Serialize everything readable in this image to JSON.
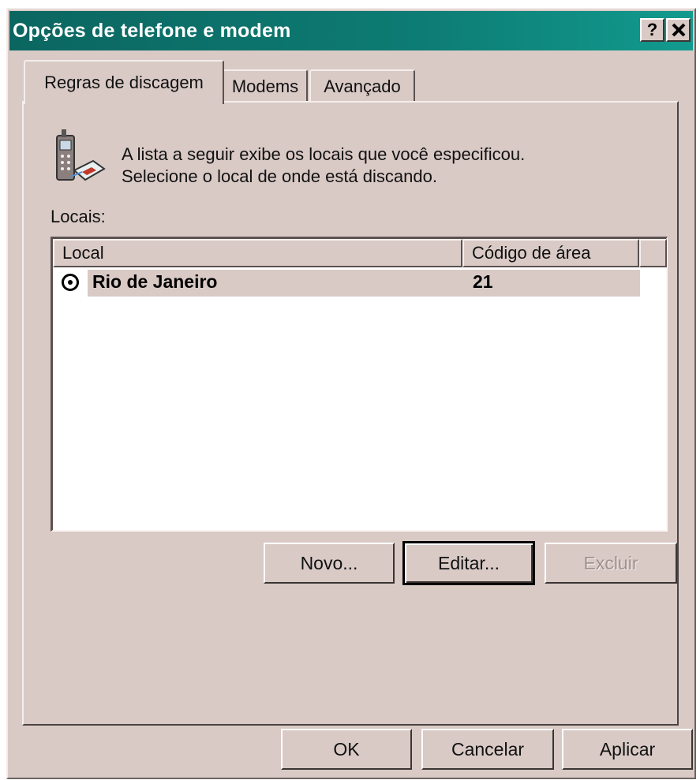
{
  "window": {
    "title": "Opções de telefone e modem",
    "help_button": "?",
    "close_button": "✕"
  },
  "tabs": [
    {
      "label": "Regras de discagem",
      "active": true
    },
    {
      "label": "Modems",
      "active": false
    },
    {
      "label": "Avançado",
      "active": false
    }
  ],
  "intro": {
    "line1": "A lista a seguir exibe os locais que você especificou.",
    "line2": "Selecione o local de onde está discando.",
    "icon": "phone-modem-icon"
  },
  "locations": {
    "label": "Locais:",
    "columns": [
      "Local",
      "Código de área"
    ],
    "rows": [
      {
        "local": "Rio de Janeiro",
        "codigo": "21",
        "selected": true
      }
    ]
  },
  "list_buttons": {
    "new": "Novo...",
    "edit": "Editar...",
    "delete": "Excluir"
  },
  "dialog_buttons": {
    "ok": "OK",
    "cancel": "Cancelar",
    "apply": "Aplicar"
  },
  "colors": {
    "titlebar": "#0d7c74",
    "face": "#d9cac6",
    "disabled_text": "#9e918e"
  }
}
